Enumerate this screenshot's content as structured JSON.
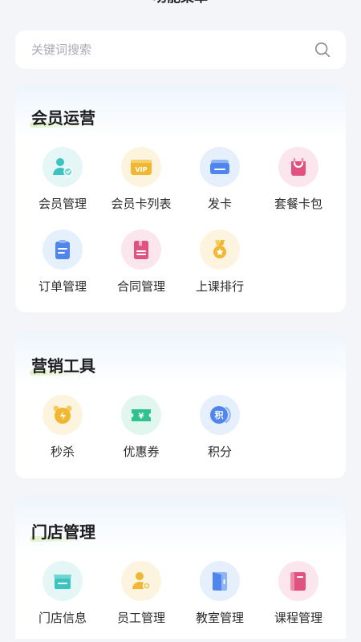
{
  "page_title": "功能菜单",
  "search": {
    "placeholder": "关键词搜索"
  },
  "sections": [
    {
      "title": "会员运营",
      "items": [
        {
          "label": "会员管理",
          "icon": "member-icon"
        },
        {
          "label": "会员卡列表",
          "icon": "vip-card-icon"
        },
        {
          "label": "发卡",
          "icon": "issue-card-icon"
        },
        {
          "label": "套餐卡包",
          "icon": "package-bag-icon"
        },
        {
          "label": "订单管理",
          "icon": "order-icon"
        },
        {
          "label": "合同管理",
          "icon": "contract-icon"
        },
        {
          "label": "上课排行",
          "icon": "medal-icon"
        }
      ]
    },
    {
      "title": "营销工具",
      "items": [
        {
          "label": "秒杀",
          "icon": "alarm-clock-icon"
        },
        {
          "label": "优惠券",
          "icon": "coupon-icon"
        },
        {
          "label": "积分",
          "icon": "points-icon"
        }
      ]
    },
    {
      "title": "门店管理",
      "items": [
        {
          "label": "门店信息",
          "icon": "store-icon"
        },
        {
          "label": "员工管理",
          "icon": "staff-icon"
        },
        {
          "label": "教室管理",
          "icon": "classroom-door-icon"
        },
        {
          "label": "课程管理",
          "icon": "course-book-icon"
        }
      ]
    }
  ],
  "icon_badges": {
    "vip": "VIP",
    "coupon": "¥",
    "points": "积"
  },
  "colors": {
    "teal": "#3cc3c0",
    "yellow": "#f2b731",
    "blue": "#4f86ee",
    "pink": "#e0527f",
    "green": "#2fc28f"
  }
}
